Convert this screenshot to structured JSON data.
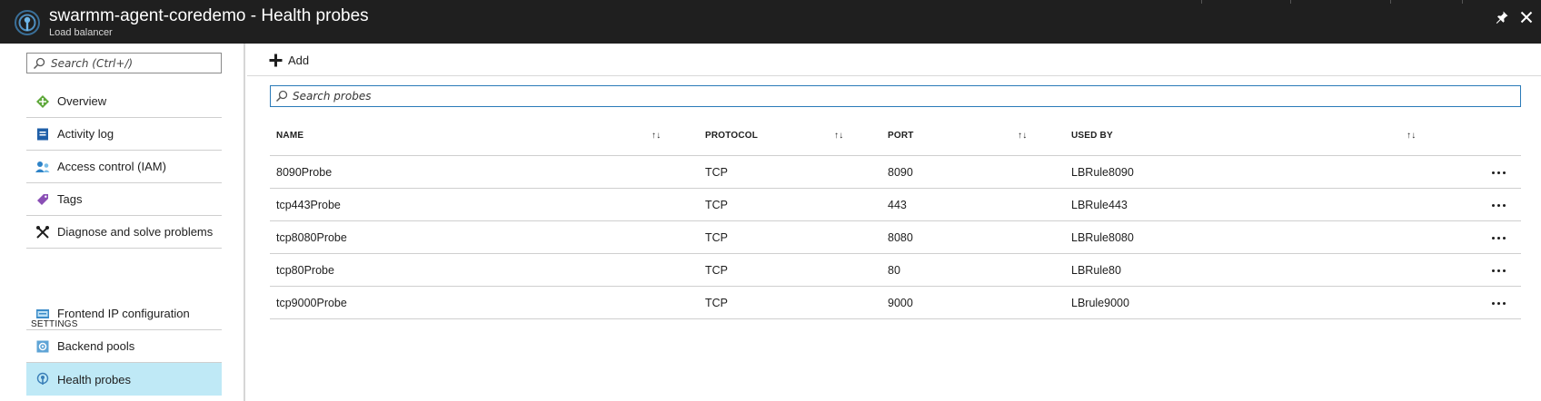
{
  "header": {
    "title": "swarmm-agent-coredemo - Health probes",
    "subtitle": "Load balancer",
    "pin_icon": "pin-icon",
    "close_icon": "close-icon"
  },
  "sidebar": {
    "search_placeholder": "Search (Ctrl+/)",
    "items": [
      {
        "label": "Overview",
        "icon": "overview-icon"
      },
      {
        "label": "Activity log",
        "icon": "activity-log-icon"
      },
      {
        "label": "Access control (IAM)",
        "icon": "iam-icon"
      },
      {
        "label": "Tags",
        "icon": "tag-icon"
      },
      {
        "label": "Diagnose and solve problems",
        "icon": "wrench-icon"
      }
    ],
    "settings_header": "SETTINGS",
    "settings_items": [
      {
        "label": "Frontend IP configuration",
        "icon": "frontend-ip-icon"
      },
      {
        "label": "Backend pools",
        "icon": "backend-pool-icon"
      },
      {
        "label": "Health probes",
        "icon": "health-probe-icon",
        "active": true
      }
    ]
  },
  "toolbar": {
    "add_label": "Add"
  },
  "probes": {
    "search_placeholder": "Search probes",
    "columns": [
      "NAME",
      "PROTOCOL",
      "PORT",
      "USED BY"
    ],
    "rows": [
      {
        "name": "8090Probe",
        "protocol": "TCP",
        "port": "8090",
        "used_by": "LBRule8090"
      },
      {
        "name": "tcp443Probe",
        "protocol": "TCP",
        "port": "443",
        "used_by": "LBRule443"
      },
      {
        "name": "tcp8080Probe",
        "protocol": "TCP",
        "port": "8080",
        "used_by": "LBRule8080"
      },
      {
        "name": "tcp80Probe",
        "protocol": "TCP",
        "port": "80",
        "used_by": "LBRule80"
      },
      {
        "name": "tcp9000Probe",
        "protocol": "TCP",
        "port": "9000",
        "used_by": "LBrule9000"
      }
    ]
  },
  "colors": {
    "header_bg": "#1f1f1f",
    "active_item_bg": "#bfe9f6",
    "search_focus_border": "#2a7ab8"
  }
}
